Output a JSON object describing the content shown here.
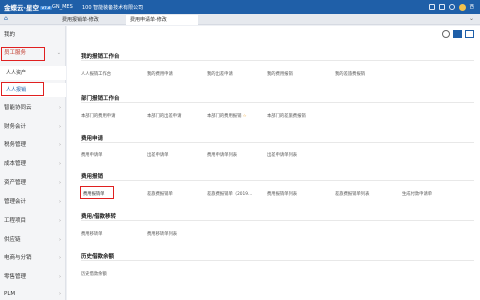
{
  "topbar": {
    "logo": "金蝶云·星空",
    "badge": "V7.6",
    "env": "GN_MES",
    "org": "100 智能装备技术有限公司",
    "user": "西"
  },
  "tabs": [
    {
      "label": "费用报销单-修改"
    },
    {
      "label": "费用申请单-修改"
    }
  ],
  "sidebar": {
    "items": [
      {
        "label": "我的"
      },
      {
        "label": "员工服务"
      },
      {
        "label": "人人资产"
      },
      {
        "label": "人人报销"
      },
      {
        "label": "智能协同云"
      },
      {
        "label": "财务会计"
      },
      {
        "label": "税务管理"
      },
      {
        "label": "成本管理"
      },
      {
        "label": "资产管理"
      },
      {
        "label": "管理会计"
      },
      {
        "label": "工程项目"
      },
      {
        "label": "供应链"
      },
      {
        "label": "电商与分销"
      },
      {
        "label": "零售管理"
      },
      {
        "label": "PLM"
      }
    ]
  },
  "sections": [
    {
      "title": "我的报销工作台",
      "links": [
        "人人报销工作台",
        "我的费用申请",
        "我的出差申请",
        "我的费用报销",
        "我的差旅费报销"
      ]
    },
    {
      "title": "部门报销工作台",
      "links": [
        "本部门的费用申请",
        "本部门的出差申请",
        "本部门的费用报销",
        "本部门的差旅费报销"
      ]
    },
    {
      "title": "费用申请",
      "links": [
        "费用申请单",
        "出差申请单",
        "费用申请单列表",
        "出差申请单列表"
      ]
    },
    {
      "title": "费用报销",
      "links": [
        "费用报销单",
        "差旅费报销单",
        "差旅费报销单（2019…",
        "费用报销单列表",
        "差旅费报销单列表",
        "生成付款申请单"
      ]
    },
    {
      "title": "费用/借款移转",
      "links": [
        "费用移转单",
        "费用移转单列表"
      ]
    },
    {
      "title": "历史借款余额",
      "links": [
        "历史借款余额"
      ]
    }
  ]
}
